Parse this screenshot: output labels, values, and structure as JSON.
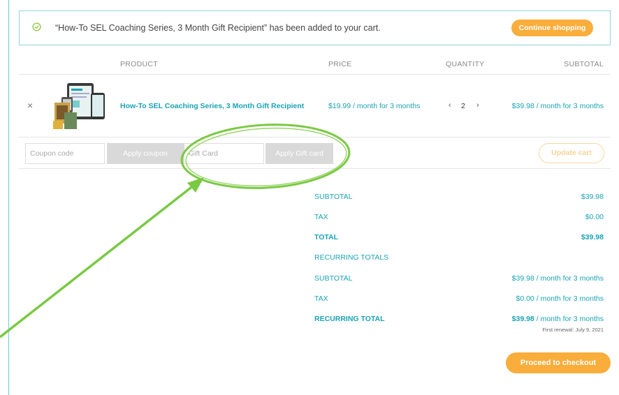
{
  "notice": {
    "message": "“How-To SEL Coaching Series, 3 Month Gift Recipient” has been added to your cart.",
    "continue_label": "Continue shopping",
    "icon": "check-circle-icon"
  },
  "table": {
    "headers": {
      "product": "PRODUCT",
      "price": "PRICE",
      "quantity": "QUANTITY",
      "subtotal": "SUBTOTAL"
    },
    "item": {
      "remove": "×",
      "name": "How-To SEL Coaching Series, 3 Month Gift Recipient",
      "price": "$19.99 / month for 3 months",
      "qty_minus": "‹",
      "quantity": "2",
      "qty_plus": "›",
      "subtotal": "$39.98 / month for 3 months"
    }
  },
  "actions": {
    "coupon_placeholder": "Coupon code",
    "apply_coupon": "Apply coupon",
    "gift_placeholder": "Gift Card",
    "apply_gift": "Apply Gift card",
    "update_cart": "Update cart"
  },
  "totals": {
    "subtotal_label": "SUBTOTAL",
    "subtotal": "$39.98",
    "tax_label": "TAX",
    "tax": "$0.00",
    "total_label": "TOTAL",
    "total": "$39.98",
    "recurring_heading": "RECURRING TOTALS",
    "r_subtotal_label": "SUBTOTAL",
    "r_subtotal": "$39.98 / month for 3 months",
    "r_tax_label": "TAX",
    "r_tax": "$0.00 / month for 3 months",
    "r_total_label": "RECURRING TOTAL",
    "r_total_amount": "$39.98",
    "r_total_suffix": " / month for 3 months",
    "renewal": "First renewal: July 9, 2021"
  },
  "checkout_label": "Proceed to checkout",
  "colors": {
    "accent": "#1aa3b5",
    "orange": "#f9ad3b",
    "annotation": "#7ac943"
  }
}
